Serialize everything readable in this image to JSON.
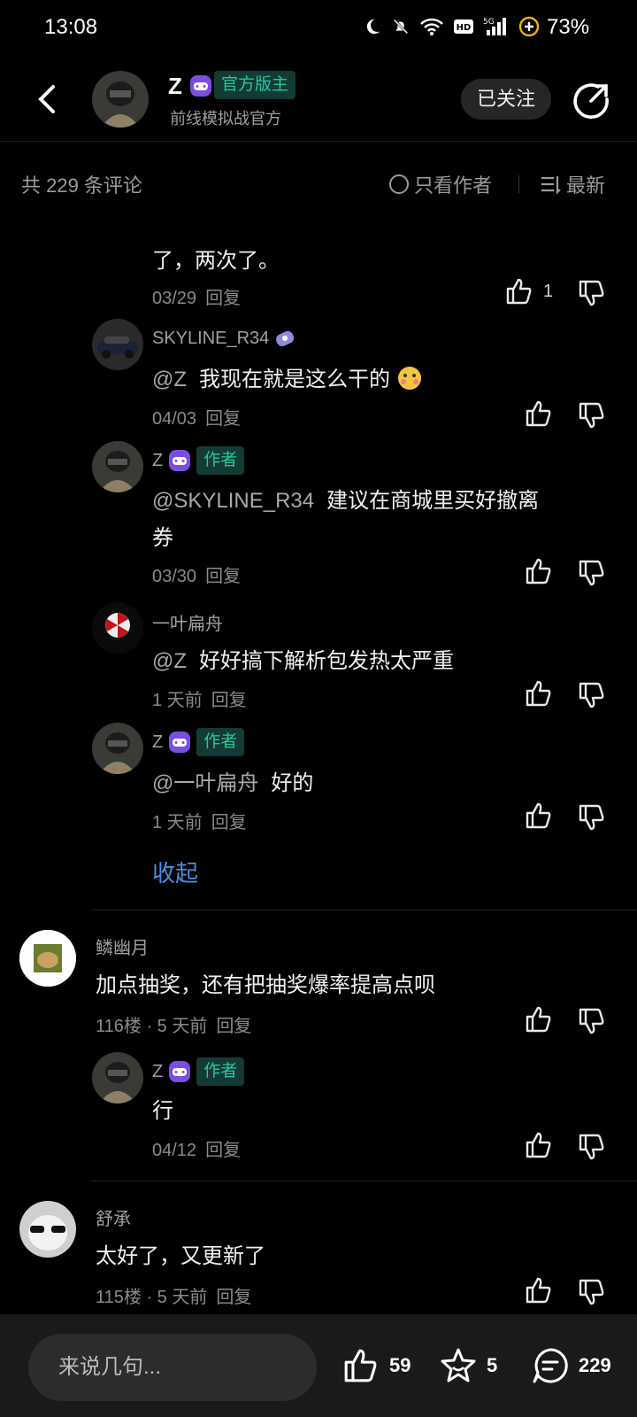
{
  "status": {
    "time": "13:08",
    "battery": "73%"
  },
  "header": {
    "name": "Z",
    "official_tag": "官方版主",
    "subtitle": "前线模拟战官方",
    "follow_label": "已关注"
  },
  "filterbar": {
    "total": "共 229 条评论",
    "only_author": "只看作者",
    "sort": "最新"
  },
  "thread": {
    "partial_text": "了，两次了。",
    "partial_date": "03/29",
    "partial_likes": "1",
    "reply_label": "回复",
    "author_tag": "作者",
    "collapse": "收起",
    "replies": [
      {
        "user": "SKYLINE_R34",
        "mention": "@Z",
        "text": "我现在就是这么干的",
        "date": "04/03"
      },
      {
        "user": "Z",
        "mention": "@SKYLINE_R34",
        "text": "建议在商城里买好撤离",
        "text2": "券",
        "date": "03/30"
      },
      {
        "user": "一叶扁舟",
        "mention": "@Z",
        "text": "好好搞下解析包发热太严重",
        "date": "1 天前"
      },
      {
        "user": "Z",
        "mention": "@一叶扁舟",
        "text": "好的",
        "date": "1 天前"
      }
    ]
  },
  "comments": [
    {
      "user": "鳞幽月",
      "text": "加点抽奖，还有把抽奖爆率提高点呗",
      "meta": "116楼 · 5 天前",
      "reply": {
        "user": "Z",
        "text": "行",
        "date": "04/12"
      }
    },
    {
      "user": "舒承",
      "text": "太好了，又更新了",
      "meta": "115楼 · 5 天前"
    }
  ],
  "bottom": {
    "placeholder": "来说几句...",
    "likes": "59",
    "stars": "5",
    "comments": "229"
  }
}
